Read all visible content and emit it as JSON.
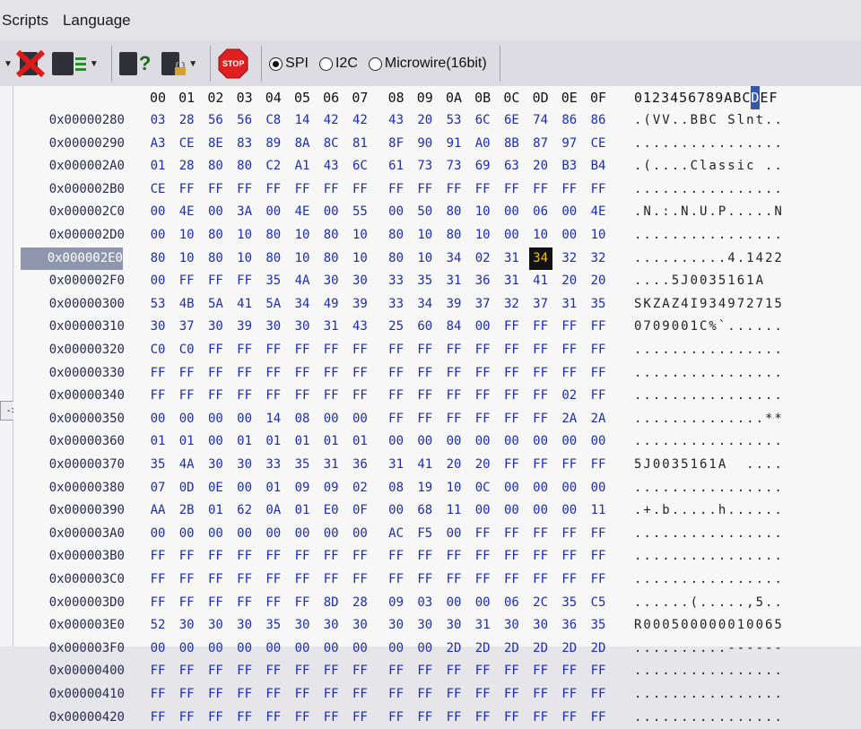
{
  "menubar": {
    "items": [
      "Scripts",
      "Language"
    ]
  },
  "toolbar": {
    "stop_label": "STOP",
    "radios": [
      {
        "label": "SPI",
        "selected": true
      },
      {
        "label": "I2C",
        "selected": false
      },
      {
        "label": "Microwire(16bit)",
        "selected": false
      }
    ]
  },
  "arrow_button": "->",
  "header": {
    "cols": [
      "00",
      "01",
      "02",
      "03",
      "04",
      "05",
      "06",
      "07",
      "08",
      "09",
      "0A",
      "0B",
      "0C",
      "0D",
      "0E",
      "0F"
    ],
    "ascii_pre": "0123456789ABC",
    "ascii_cursor": "D",
    "ascii_post": "EF"
  },
  "rows": [
    {
      "addr": "0x00000280",
      "bytes": [
        "03",
        "28",
        "56",
        "56",
        "C8",
        "14",
        "42",
        "42",
        "43",
        "20",
        "53",
        "6C",
        "6E",
        "74",
        "86",
        "86"
      ],
      "ascii": ".(VV..BBC Slnt.."
    },
    {
      "addr": "0x00000290",
      "bytes": [
        "A3",
        "CE",
        "8E",
        "83",
        "89",
        "8A",
        "8C",
        "81",
        "8F",
        "90",
        "91",
        "A0",
        "8B",
        "87",
        "97",
        "CE"
      ],
      "ascii": "................"
    },
    {
      "addr": "0x000002A0",
      "bytes": [
        "01",
        "28",
        "80",
        "80",
        "C2",
        "A1",
        "43",
        "6C",
        "61",
        "73",
        "73",
        "69",
        "63",
        "20",
        "B3",
        "B4"
      ],
      "ascii": ".(....Classic .."
    },
    {
      "addr": "0x000002B0",
      "bytes": [
        "CE",
        "FF",
        "FF",
        "FF",
        "FF",
        "FF",
        "FF",
        "FF",
        "FF",
        "FF",
        "FF",
        "FF",
        "FF",
        "FF",
        "FF",
        "FF"
      ],
      "ascii": "................"
    },
    {
      "addr": "0x000002C0",
      "bytes": [
        "00",
        "4E",
        "00",
        "3A",
        "00",
        "4E",
        "00",
        "55",
        "00",
        "50",
        "80",
        "10",
        "00",
        "06",
        "00",
        "4E"
      ],
      "ascii": ".N.:.N.U.P.....N"
    },
    {
      "addr": "0x000002D0",
      "bytes": [
        "00",
        "10",
        "80",
        "10",
        "80",
        "10",
        "80",
        "10",
        "80",
        "10",
        "80",
        "10",
        "00",
        "10",
        "00",
        "10"
      ],
      "ascii": "................"
    },
    {
      "addr": "0x000002E0",
      "bytes": [
        "80",
        "10",
        "80",
        "10",
        "80",
        "10",
        "80",
        "10",
        "80",
        "10",
        "34",
        "02",
        "31",
        "34",
        "32",
        "32"
      ],
      "ascii": "..........4.1422",
      "selected": true,
      "highlight": 13
    },
    {
      "addr": "0x000002F0",
      "bytes": [
        "00",
        "FF",
        "FF",
        "FF",
        "35",
        "4A",
        "30",
        "30",
        "33",
        "35",
        "31",
        "36",
        "31",
        "41",
        "20",
        "20"
      ],
      "ascii": "....5J0035161A  "
    },
    {
      "addr": "0x00000300",
      "bytes": [
        "53",
        "4B",
        "5A",
        "41",
        "5A",
        "34",
        "49",
        "39",
        "33",
        "34",
        "39",
        "37",
        "32",
        "37",
        "31",
        "35"
      ],
      "ascii": "SKZAZ4I934972715"
    },
    {
      "addr": "0x00000310",
      "bytes": [
        "30",
        "37",
        "30",
        "39",
        "30",
        "30",
        "31",
        "43",
        "25",
        "60",
        "84",
        "00",
        "FF",
        "FF",
        "FF",
        "FF"
      ],
      "ascii": "0709001C%`......"
    },
    {
      "addr": "0x00000320",
      "bytes": [
        "C0",
        "C0",
        "FF",
        "FF",
        "FF",
        "FF",
        "FF",
        "FF",
        "FF",
        "FF",
        "FF",
        "FF",
        "FF",
        "FF",
        "FF",
        "FF"
      ],
      "ascii": "................"
    },
    {
      "addr": "0x00000330",
      "bytes": [
        "FF",
        "FF",
        "FF",
        "FF",
        "FF",
        "FF",
        "FF",
        "FF",
        "FF",
        "FF",
        "FF",
        "FF",
        "FF",
        "FF",
        "FF",
        "FF"
      ],
      "ascii": "................"
    },
    {
      "addr": "0x00000340",
      "bytes": [
        "FF",
        "FF",
        "FF",
        "FF",
        "FF",
        "FF",
        "FF",
        "FF",
        "FF",
        "FF",
        "FF",
        "FF",
        "FF",
        "FF",
        "02",
        "FF"
      ],
      "ascii": "................"
    },
    {
      "addr": "0x00000350",
      "bytes": [
        "00",
        "00",
        "00",
        "00",
        "14",
        "08",
        "00",
        "00",
        "FF",
        "FF",
        "FF",
        "FF",
        "FF",
        "FF",
        "2A",
        "2A"
      ],
      "ascii": "..............**"
    },
    {
      "addr": "0x00000360",
      "bytes": [
        "01",
        "01",
        "00",
        "01",
        "01",
        "01",
        "01",
        "01",
        "00",
        "00",
        "00",
        "00",
        "00",
        "00",
        "00",
        "00"
      ],
      "ascii": "................"
    },
    {
      "addr": "0x00000370",
      "bytes": [
        "35",
        "4A",
        "30",
        "30",
        "33",
        "35",
        "31",
        "36",
        "31",
        "41",
        "20",
        "20",
        "FF",
        "FF",
        "FF",
        "FF"
      ],
      "ascii": "5J0035161A  ...."
    },
    {
      "addr": "0x00000380",
      "bytes": [
        "07",
        "0D",
        "0E",
        "00",
        "01",
        "09",
        "09",
        "02",
        "08",
        "19",
        "10",
        "0C",
        "00",
        "00",
        "00",
        "00"
      ],
      "ascii": "................"
    },
    {
      "addr": "0x00000390",
      "bytes": [
        "AA",
        "2B",
        "01",
        "62",
        "0A",
        "01",
        "E0",
        "0F",
        "00",
        "68",
        "11",
        "00",
        "00",
        "00",
        "00",
        "11"
      ],
      "ascii": ".+.b.....h......"
    },
    {
      "addr": "0x000003A0",
      "bytes": [
        "00",
        "00",
        "00",
        "00",
        "00",
        "00",
        "00",
        "00",
        "AC",
        "F5",
        "00",
        "FF",
        "FF",
        "FF",
        "FF",
        "FF"
      ],
      "ascii": "................"
    },
    {
      "addr": "0x000003B0",
      "bytes": [
        "FF",
        "FF",
        "FF",
        "FF",
        "FF",
        "FF",
        "FF",
        "FF",
        "FF",
        "FF",
        "FF",
        "FF",
        "FF",
        "FF",
        "FF",
        "FF"
      ],
      "ascii": "................"
    },
    {
      "addr": "0x000003C0",
      "bytes": [
        "FF",
        "FF",
        "FF",
        "FF",
        "FF",
        "FF",
        "FF",
        "FF",
        "FF",
        "FF",
        "FF",
        "FF",
        "FF",
        "FF",
        "FF",
        "FF"
      ],
      "ascii": "................"
    },
    {
      "addr": "0x000003D0",
      "bytes": [
        "FF",
        "FF",
        "FF",
        "FF",
        "FF",
        "FF",
        "8D",
        "28",
        "09",
        "03",
        "00",
        "00",
        "06",
        "2C",
        "35",
        "C5"
      ],
      "ascii": "......(.....,5.."
    },
    {
      "addr": "0x000003E0",
      "bytes": [
        "52",
        "30",
        "30",
        "30",
        "35",
        "30",
        "30",
        "30",
        "30",
        "30",
        "30",
        "31",
        "30",
        "30",
        "36",
        "35"
      ],
      "ascii": "R000500000010065"
    },
    {
      "addr": "0x000003F0",
      "bytes": [
        "00",
        "00",
        "00",
        "00",
        "00",
        "00",
        "00",
        "00",
        "00",
        "00",
        "2D",
        "2D",
        "2D",
        "2D",
        "2D",
        "2D"
      ],
      "ascii": "..........------"
    },
    {
      "addr": "0x00000400",
      "bytes": [
        "FF",
        "FF",
        "FF",
        "FF",
        "FF",
        "FF",
        "FF",
        "FF",
        "FF",
        "FF",
        "FF",
        "FF",
        "FF",
        "FF",
        "FF",
        "FF"
      ],
      "ascii": "................"
    },
    {
      "addr": "0x00000410",
      "bytes": [
        "FF",
        "FF",
        "FF",
        "FF",
        "FF",
        "FF",
        "FF",
        "FF",
        "FF",
        "FF",
        "FF",
        "FF",
        "FF",
        "FF",
        "FF",
        "FF"
      ],
      "ascii": "................"
    },
    {
      "addr": "0x00000420",
      "bytes": [
        "FF",
        "FF",
        "FF",
        "FF",
        "FF",
        "FF",
        "FF",
        "FF",
        "FF",
        "FF",
        "FF",
        "FF",
        "FF",
        "FF",
        "FF",
        "FF"
      ],
      "ascii": "................"
    }
  ]
}
